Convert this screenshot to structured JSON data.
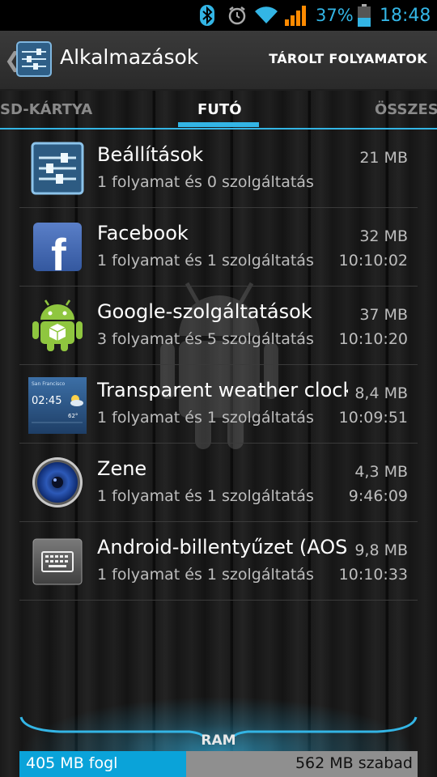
{
  "status_bar": {
    "battery_percent": "37%",
    "time": "18:48",
    "accent_color": "#33b5e5",
    "icons": [
      "bluetooth-icon",
      "alarm-icon",
      "wifi-icon",
      "signal-icon",
      "battery-icon"
    ]
  },
  "action_bar": {
    "title": "Alkalmazások",
    "action_label": "TÁROLT FOLYAMATOK"
  },
  "tabs": [
    {
      "label": "SD-KÁRTYA",
      "active": false
    },
    {
      "label": "FUTÓ",
      "active": true
    },
    {
      "label": "ÖSSZES",
      "active": false
    }
  ],
  "apps": [
    {
      "name": "Beállítások",
      "subtitle": "1 folyamat és 0 szolgáltatás",
      "size": "21 MB",
      "time": "",
      "icon": "settings-icon"
    },
    {
      "name": "Facebook",
      "subtitle": "1 folyamat és 1 szolgáltatás",
      "size": "32 MB",
      "time": "10:10:02",
      "icon": "facebook-icon"
    },
    {
      "name": "Google-szolgáltatások",
      "subtitle": "3 folyamat és 5 szolgáltatás",
      "size": "37 MB",
      "time": "10:10:20",
      "icon": "android-icon"
    },
    {
      "name": "Transparent weather clock",
      "subtitle": "1 folyamat és 1 szolgáltatás",
      "size": "8,4 MB",
      "time": "10:09:51",
      "icon": "weather-clock-icon"
    },
    {
      "name": "Zene",
      "subtitle": "1 folyamat és 1 szolgáltatás",
      "size": "4,3 MB",
      "time": "9:46:09",
      "icon": "music-speaker-icon"
    },
    {
      "name": "Android-billentyűzet (AOSP)",
      "subtitle": "1 folyamat és 1 szolgáltatás",
      "size": "9,8 MB",
      "time": "10:10:33",
      "icon": "keyboard-icon"
    }
  ],
  "ram": {
    "label": "RAM",
    "used_text": "405 MB fogl",
    "free_text": "562 MB szabad",
    "used_fraction": 0.418
  },
  "weather_widget": {
    "city": "San Francisco",
    "time": "02:45",
    "temp": "62°"
  }
}
